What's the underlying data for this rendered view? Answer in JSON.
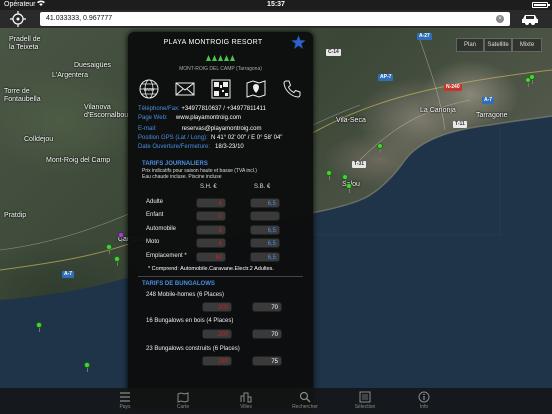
{
  "status_bar": {
    "carrier": "Opérateur",
    "time": "15:37"
  },
  "toolbar": {
    "search_value": "41.033333, 0.967777",
    "search_clear": "×"
  },
  "map": {
    "places": [
      {
        "name": "Pradell de\nla Teixeta"
      },
      {
        "name": "Duesaigües"
      },
      {
        "name": "L'Argentera"
      },
      {
        "name": "Torre de\nFontaubella"
      },
      {
        "name": "Vilanova\nd'Escornalbou"
      },
      {
        "name": "Colldejou"
      },
      {
        "name": "Mont-Roig del Camp"
      },
      {
        "name": "Pratdip"
      },
      {
        "name": "Vila-Seca"
      },
      {
        "name": "La Canonja"
      },
      {
        "name": "Tarragone"
      },
      {
        "name": "Salou"
      },
      {
        "name": "Cambrils"
      }
    ],
    "shields": [
      {
        "label": "C-14"
      },
      {
        "label": "A-27"
      },
      {
        "label": "AP-7"
      },
      {
        "label": "N-240"
      },
      {
        "label": "A-7"
      },
      {
        "label": "T-11"
      },
      {
        "label": "A-7"
      },
      {
        "label": "T-31"
      }
    ],
    "map_type_buttons": [
      "Plan",
      "Satellite",
      "Mixte"
    ]
  },
  "panel": {
    "title": "PLAYA MONTROIG RESORT",
    "location": "MONT-ROIG DEL CAMP (Tarragona)",
    "contact": [
      {
        "key": "Téléphone/Fax:",
        "value": "+34977810637 / +34977811411"
      },
      {
        "key": "Page Web:",
        "value": "www.playamontroig.com"
      },
      {
        "key": "E-mail:",
        "value": "reservas@playamontroig.com"
      },
      {
        "key": "Position GPS (Lat / Long):",
        "value": "N 41° 02' 00\" / E 0° 58' 04\""
      },
      {
        "key": "Date Ouverture/Fermeture:",
        "value": "18/3-23/10"
      }
    ],
    "tarifs_title": "TARIFS JOURNALIERS",
    "tarifs_note_1": "Prix indicatifs pour saison haute et basse (TVA incl.)",
    "tarifs_note_2": "Eau chaude incluse.   Piscine incluse",
    "col_sh": "S.H. €",
    "col_sb": "S.B. €",
    "rows": [
      {
        "label": "Adulte",
        "sh": "6",
        "sb": "6,5"
      },
      {
        "label": "Enfant",
        "sh": "0",
        "sb": ""
      },
      {
        "label": "Automobile",
        "sh": "6",
        "sb": "6,5"
      },
      {
        "label": "Moto",
        "sh": "6",
        "sb": "6,5"
      },
      {
        "label": "Emplacement   *",
        "sh": "60",
        "sb": "6,5"
      }
    ],
    "comprend": "* Comprend: Automobile.Caravane.Electr.2 Adultes.",
    "bungalows_title": "TARIFS DE BUNGALOWS",
    "bungalows": [
      {
        "label": "248 Mobile-homes   (6 Places)",
        "sh": "200",
        "sb": "70"
      },
      {
        "label": "16 Bungalows en bois   (4 Places)",
        "sh": "200",
        "sb": "70"
      },
      {
        "label": "23 Bungalows construits   (6 Places)",
        "sh": "280",
        "sb": "75"
      }
    ]
  },
  "tabbar": {
    "tabs": [
      {
        "label": "Pays"
      },
      {
        "label": "Carte"
      },
      {
        "label": "Villes"
      },
      {
        "label": "Rechercher"
      },
      {
        "label": "Sélection"
      },
      {
        "label": "Info"
      }
    ]
  }
}
